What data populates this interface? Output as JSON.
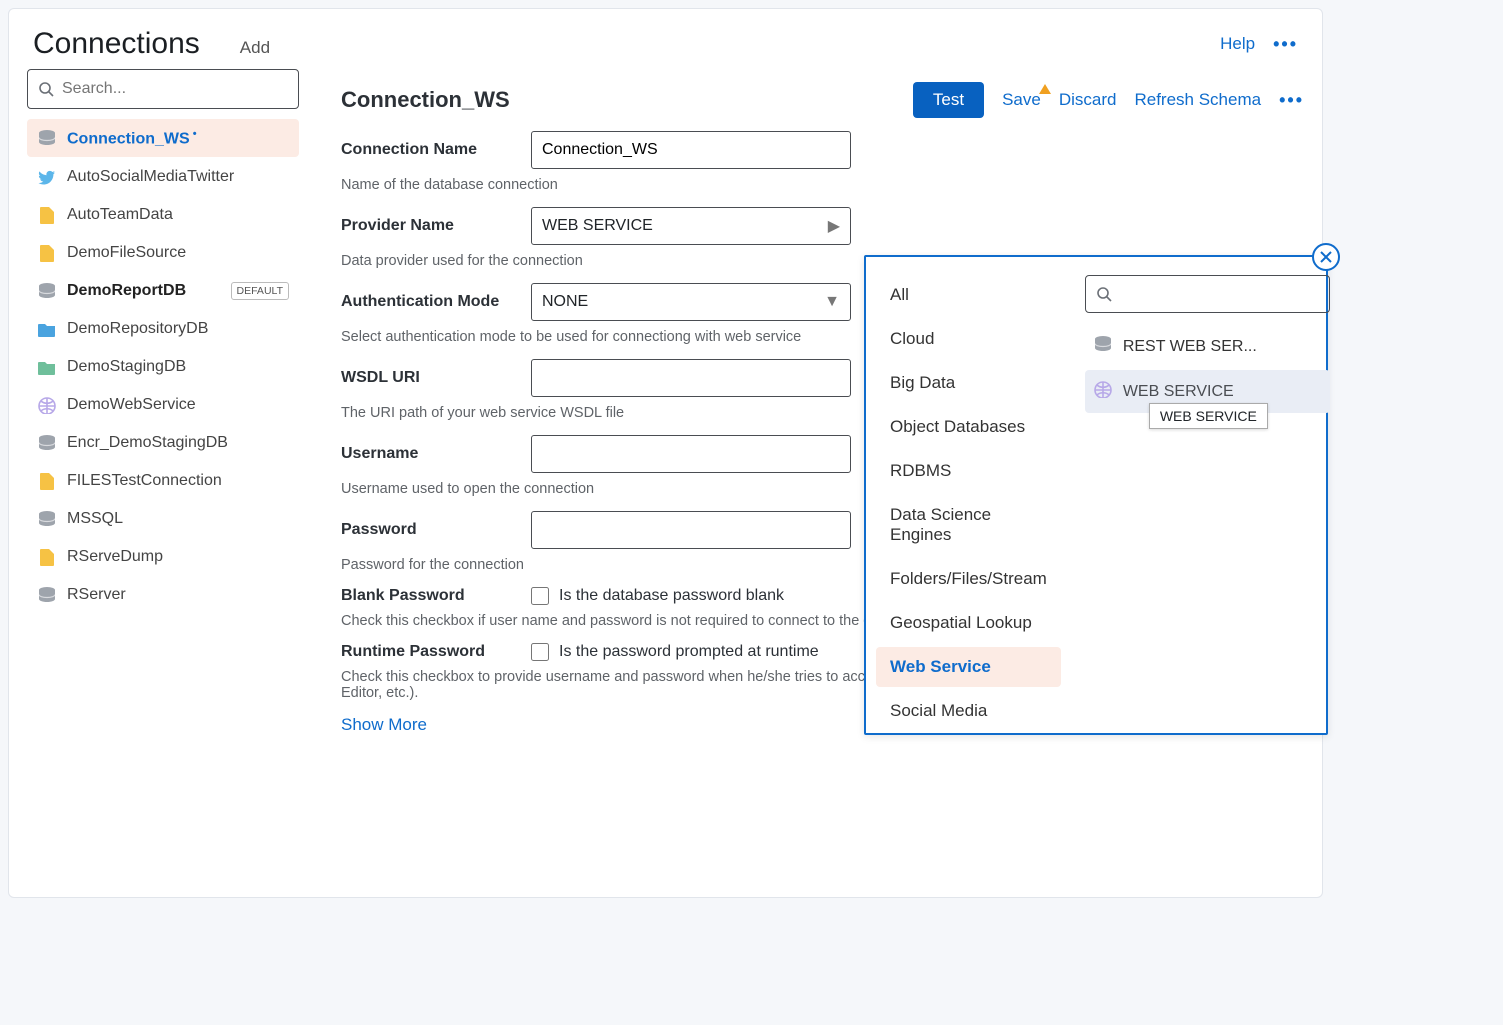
{
  "header": {
    "title": "Connections",
    "add": "Add",
    "help": "Help"
  },
  "sidebar": {
    "search_placeholder": "Search...",
    "items": [
      {
        "label": "Connection_WS",
        "icon": "db",
        "selected": true
      },
      {
        "label": "AutoSocialMediaTwitter",
        "icon": "twitter"
      },
      {
        "label": "AutoTeamData",
        "icon": "file"
      },
      {
        "label": "DemoFileSource",
        "icon": "file"
      },
      {
        "label": "DemoReportDB",
        "icon": "db",
        "bold": true,
        "default_badge": "DEFAULT"
      },
      {
        "label": "DemoRepositoryDB",
        "icon": "folder"
      },
      {
        "label": "DemoStagingDB",
        "icon": "foldergear"
      },
      {
        "label": "DemoWebService",
        "icon": "globe"
      },
      {
        "label": "Encr_DemoStagingDB",
        "icon": "db"
      },
      {
        "label": "FILESTestConnection",
        "icon": "file"
      },
      {
        "label": "MSSQL",
        "icon": "db"
      },
      {
        "label": "RServeDump",
        "icon": "file"
      },
      {
        "label": "RServer",
        "icon": "db"
      }
    ]
  },
  "detail": {
    "title": "Connection_WS",
    "actions": {
      "test": "Test",
      "save": "Save",
      "discard": "Discard",
      "refresh": "Refresh Schema"
    },
    "fields": {
      "name": {
        "label": "Connection Name",
        "value": "Connection_WS",
        "help": "Name of the database connection"
      },
      "provider": {
        "label": "Provider Name",
        "value": "WEB SERVICE",
        "help": "Data provider used for the connection"
      },
      "auth": {
        "label": "Authentication Mode",
        "value": "NONE",
        "help": "Select authentication mode to be used for connectiong with web service"
      },
      "wsdl": {
        "label": "WSDL URI",
        "value": "",
        "help": "The URI path of your web service WSDL file"
      },
      "user": {
        "label": "Username",
        "value": "",
        "help": "Username used to open the connection"
      },
      "pass": {
        "label": "Password",
        "value": "",
        "help": "Password for the connection"
      },
      "blank": {
        "label": "Blank Password",
        "check_label": "Is the database password blank",
        "help": "Check this checkbox if user name and password is not required to connect to the database."
      },
      "runtime": {
        "label": "Runtime Password",
        "check_label": "Is the password prompted at runtime",
        "help": "Check this checkbox to provide username and password when he/she tries to access database (for example, to generate a report or to open SQL Editor, etc.)."
      }
    },
    "show_more": "Show More"
  },
  "popup": {
    "categories": [
      "All",
      "Cloud",
      "Big Data",
      "Object Databases",
      "RDBMS",
      "Data Science Engines",
      "Folders/Files/Stream",
      "Geospatial Lookup",
      "Web Service",
      "Social Media"
    ],
    "active_category": "Web Service",
    "results": [
      {
        "label": "REST WEB SER...",
        "icon": "db"
      },
      {
        "label": "WEB SERVICE",
        "icon": "globe",
        "active": true
      }
    ],
    "tooltip": "WEB SERVICE"
  }
}
